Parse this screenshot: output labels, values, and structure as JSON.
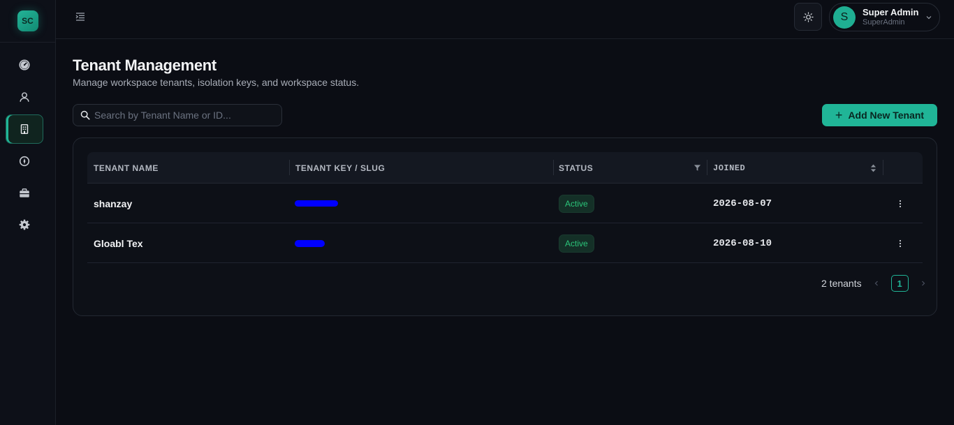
{
  "logo": {
    "text": "SC"
  },
  "sidebar": {
    "items": [
      {
        "name": "dashboard",
        "icon": "gauge-icon"
      },
      {
        "name": "users",
        "icon": "user-icon"
      },
      {
        "name": "tenants",
        "icon": "building-icon",
        "active": true
      },
      {
        "name": "info",
        "icon": "compass-icon"
      },
      {
        "name": "briefcase",
        "icon": "briefcase-icon"
      },
      {
        "name": "settings",
        "icon": "gear-icon"
      }
    ]
  },
  "header": {
    "user": {
      "initial": "S",
      "name": "Super Admin",
      "role": "SuperAdmin"
    }
  },
  "page": {
    "title": "Tenant Management",
    "subtitle": "Manage workspace tenants, isolation keys, and workspace status."
  },
  "search": {
    "placeholder": "Search by Tenant Name or ID...",
    "value": ""
  },
  "actions": {
    "add_label": "Add New Tenant"
  },
  "table": {
    "columns": {
      "name": "TENANT NAME",
      "key": "TENANT KEY / SLUG",
      "status": "STATUS",
      "joined": "JOINED"
    },
    "rows": [
      {
        "name": "shanzay",
        "key_redacted": true,
        "status": "Active",
        "joined": "2026-08-07"
      },
      {
        "name": "Gloabl Tex",
        "key_redacted": true,
        "status": "Active",
        "joined": "2026-08-10"
      }
    ]
  },
  "pagination": {
    "total": "2 tenants",
    "current_page": "1"
  },
  "colors": {
    "accent": "#20b597",
    "background": "#0b0d14",
    "status_active": "#2bc57a",
    "redaction": "#0000ff"
  }
}
